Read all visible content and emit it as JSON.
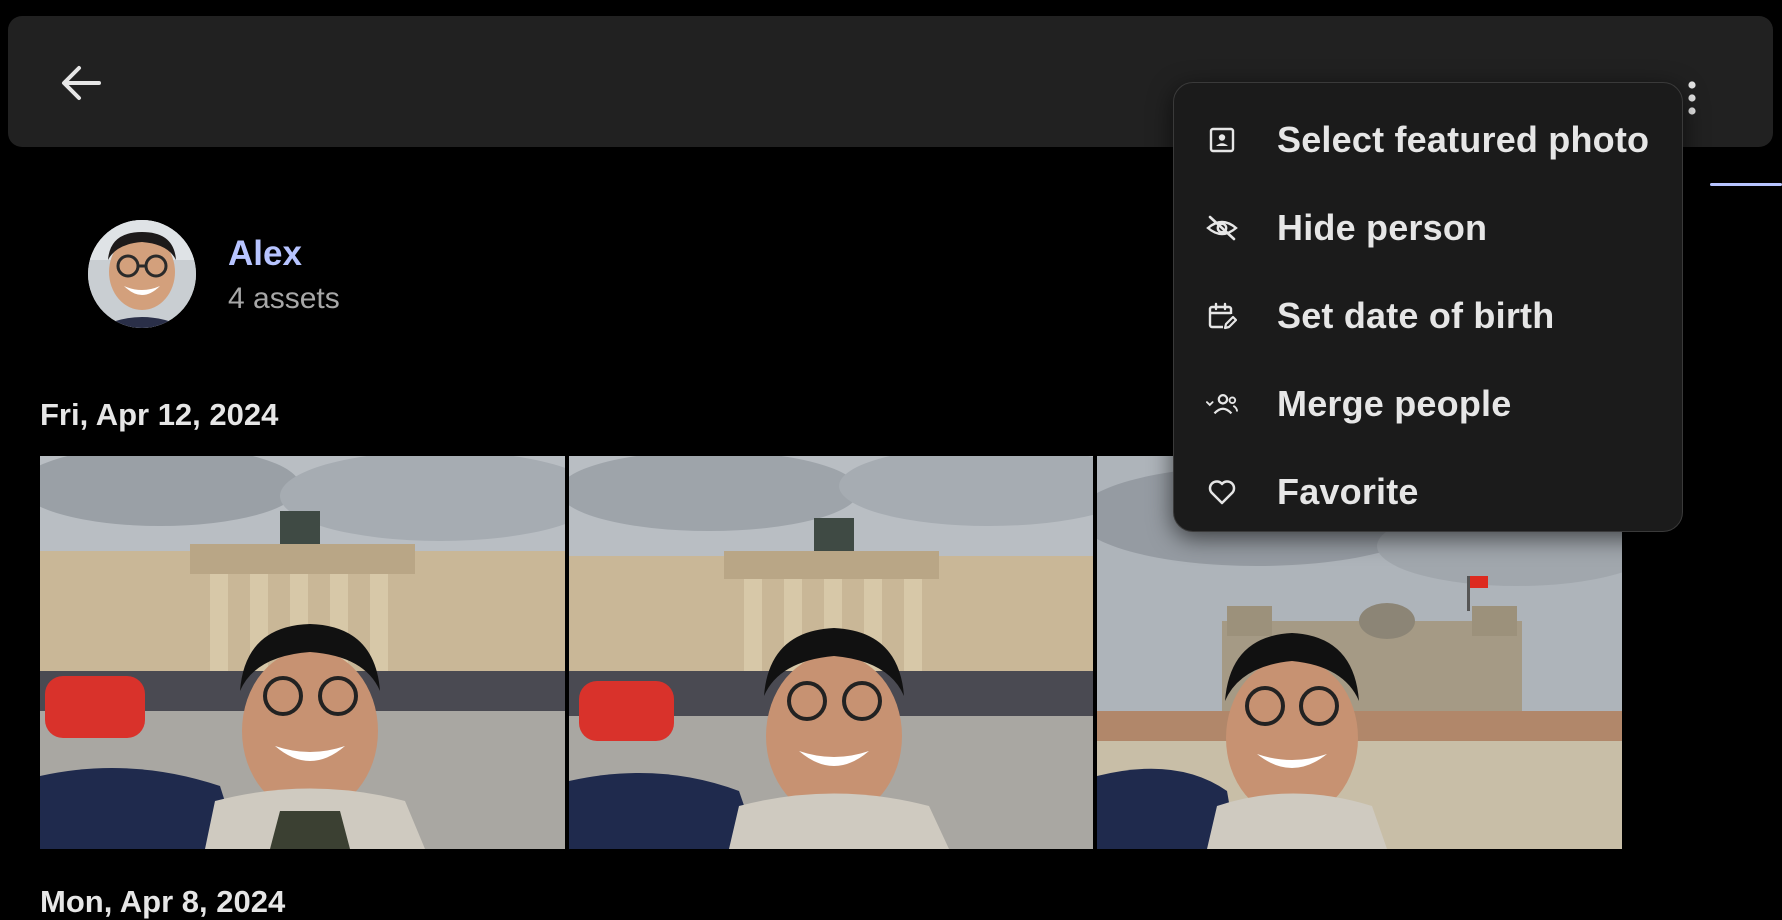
{
  "header": {
    "back_icon": "arrow-left-icon",
    "more_icon": "more-vertical-icon"
  },
  "menu": {
    "items": [
      {
        "label": "Select featured photo",
        "icon": "featured-photo-icon"
      },
      {
        "label": "Hide person",
        "icon": "eye-off-icon"
      },
      {
        "label": "Set date of birth",
        "icon": "calendar-edit-icon"
      },
      {
        "label": "Merge people",
        "icon": "merge-people-icon"
      },
      {
        "label": "Favorite",
        "icon": "heart-icon"
      }
    ]
  },
  "person": {
    "name": "Alex",
    "asset_count": "4 assets"
  },
  "groups": [
    {
      "date": "Fri, Apr 12, 2024"
    },
    {
      "date": "Mon, Apr 8, 2024"
    }
  ],
  "colors": {
    "accent": "#b7c4ff",
    "background": "#000000",
    "surface": "#212121"
  }
}
